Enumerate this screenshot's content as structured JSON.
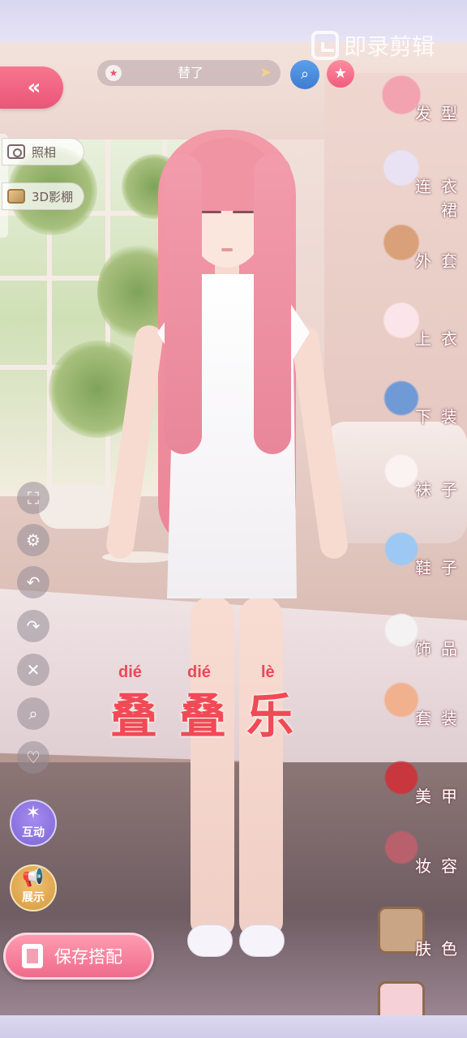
{
  "header": {
    "back_icon": "double-chevron-left-icon",
    "title": "替了",
    "title_star_icon": "star-badge-icon",
    "title_arrow_icon": "arrow-right-icon",
    "search_icon": "magnifier-icon",
    "favorite_icon": "star-icon"
  },
  "watermark": {
    "text": "即录剪辑"
  },
  "photo_buttons": [
    {
      "label": "照相",
      "icon": "camera-icon"
    },
    {
      "label": "3D影棚",
      "icon": "box-icon"
    }
  ],
  "tools": [
    {
      "name": "expand",
      "icon": "expand-icon",
      "glyph": "⛶"
    },
    {
      "name": "settings",
      "icon": "gear-icon",
      "glyph": "⚙"
    },
    {
      "name": "undo",
      "icon": "undo-icon",
      "glyph": "↶"
    },
    {
      "name": "redo",
      "icon": "redo-icon",
      "glyph": "↷"
    },
    {
      "name": "delete",
      "icon": "trash-icon",
      "glyph": "🗑"
    },
    {
      "name": "zoom",
      "icon": "search-icon",
      "glyph": "⌕"
    },
    {
      "name": "like",
      "icon": "heart-icon",
      "glyph": "♡"
    }
  ],
  "interact_button": {
    "label": "互动",
    "icon": "sparkle-star-icon"
  },
  "showcase_button": {
    "label": "展示",
    "icon": "megaphone-icon"
  },
  "save_button": {
    "label": "保存搭配",
    "icon": "outfit-card-icon"
  },
  "categories": [
    {
      "label": "发型",
      "icon": "hairstyle-icon",
      "color": "#f3a2b0"
    },
    {
      "label": "连衣裙",
      "icon": "dress-icon",
      "color": "#e9e2f4"
    },
    {
      "label": "外套",
      "icon": "coat-icon",
      "color": "#d9a079"
    },
    {
      "label": "上衣",
      "icon": "top-icon",
      "color": "#fbe5ea"
    },
    {
      "label": "下装",
      "icon": "shorts-icon",
      "color": "#6f9ad6"
    },
    {
      "label": "袜子",
      "icon": "socks-icon",
      "color": "#fbf3f1"
    },
    {
      "label": "鞋子",
      "icon": "shoe-icon",
      "color": "#9cc8f3"
    },
    {
      "label": "饰品",
      "icon": "beret-icon",
      "color": "#f4f2f3"
    },
    {
      "label": "套装",
      "icon": "outfit-set-icon",
      "color": "#f1b18f"
    },
    {
      "label": "美甲",
      "icon": "nail-polish-icon",
      "color": "#c8363e"
    },
    {
      "label": "妆容",
      "icon": "makeup-palette-icon",
      "color": "#b8606b"
    },
    {
      "label": "肤色",
      "icon": "skin-tone-icon",
      "color": "#c9a586"
    },
    {
      "label": "",
      "icon": "extra-category-icon",
      "color": "#f5d0d7"
    }
  ],
  "overlay": {
    "pinyin": [
      "dié",
      "dié",
      "lè"
    ],
    "characters": [
      "叠",
      "叠",
      "乐"
    ]
  },
  "colors": {
    "accent_pink": "#ef5d7e",
    "overlay_red": "#f04a56",
    "frame_lavender": "#dcd8f0"
  }
}
